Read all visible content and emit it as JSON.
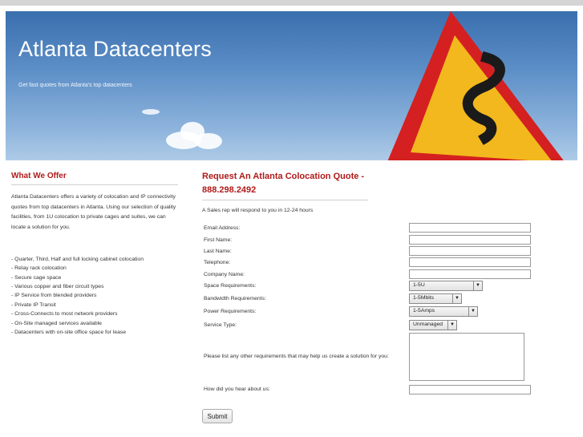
{
  "header": {
    "title": "Atlanta Datacenters",
    "subtitle": "Get fast quotes from Atlanta's top datacenters"
  },
  "offer": {
    "heading": "What We Offer",
    "description": "Atlanta Datacenters offers a variety of colocation and IP connectivity quotes from top datacenters in Atlanta. Using our selection of quality facilities, from 1U colocation to private cages and suites, we can locate a solution for you.",
    "items": [
      "- Quarter, Third, Half and full locking cabinet colocation",
      "- Relay rack colocation",
      "- Secure cage space",
      "- Various copper and fiber circuit types",
      "- IP Service from blended providers",
      "- Private IP Transit",
      "- Cross-Connects to most network providers",
      "- On-Site managed services available",
      "- Datacenters with on-site office space for lease"
    ]
  },
  "form": {
    "heading": "Request An Atlanta Colocation Quote - 888.298.2492",
    "note": "A Sales rep will respond to you in 12-24 hours",
    "labels": {
      "email": "Email Address:",
      "first_name": "First Name:",
      "last_name": "Last Name:",
      "telephone": "Telephone:",
      "company": "Company Name:",
      "space": "Space Requirements:",
      "bandwidth": "Bandwidth Requirements:",
      "power": "Power Requirements:",
      "service": "Service Type:",
      "other": "Please list any other requirements that may help us create a solution for you:",
      "hear": "How did you hear about us:"
    },
    "values": {
      "email": "",
      "first_name": "",
      "last_name": "",
      "telephone": "",
      "company": "",
      "space": "1-5U",
      "bandwidth": "1-5Mbits",
      "power": "1-5Amps",
      "service": "Unmanaged",
      "hear": ""
    },
    "submit_label": "Submit"
  },
  "icons": {
    "dropdown": "chevron-down-icon"
  },
  "colors": {
    "heading": "#b01a1a",
    "sky": "#4a7fbd",
    "sign_border": "#d42020",
    "sign_fill": "#f2b81d"
  }
}
